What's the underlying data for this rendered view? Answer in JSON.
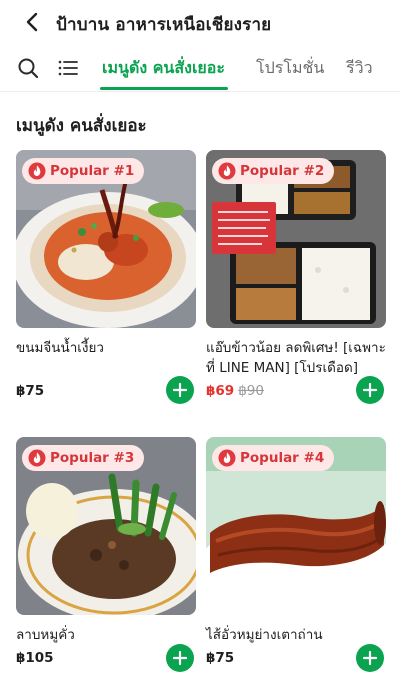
{
  "header": {
    "title": "ป้าบาน อาหารเหนือเชียงราย"
  },
  "tabs": [
    {
      "label": "เมนูดัง คนสั่งเยอะ",
      "active": true
    },
    {
      "label": "โปรโมชั่น",
      "active": false
    },
    {
      "label": "รีวิว",
      "active": false
    }
  ],
  "section": {
    "title": "เมนูดัง คนสั่งเยอะ"
  },
  "menu_items": [
    {
      "badge": "Popular #1",
      "name": "ขนมจีนน้ำเงี้ยว",
      "price": "฿75",
      "original_price": ""
    },
    {
      "badge": "Popular #2",
      "name": "แอ๊บข้าวน้อย ลดพิเศษ! [เฉพาะที่ LINE MAN] [โปรเดือด]",
      "price": "฿69",
      "original_price": "฿90"
    },
    {
      "badge": "Popular #3",
      "name": "ลาบหมูคั่ว",
      "price": "฿105",
      "original_price": ""
    },
    {
      "badge": "Popular #4",
      "name": "ไส้อั่วหมูย่างเตาถ่าน",
      "price": "฿75",
      "original_price": ""
    }
  ],
  "colors": {
    "accent": "#0aa34f",
    "sale": "#e5322d",
    "badge_bg": "#fde7e7",
    "badge_text": "#d5363a"
  },
  "icons": [
    "back-arrow-icon",
    "search-icon",
    "menu-list-icon",
    "flame-icon",
    "plus-icon"
  ]
}
